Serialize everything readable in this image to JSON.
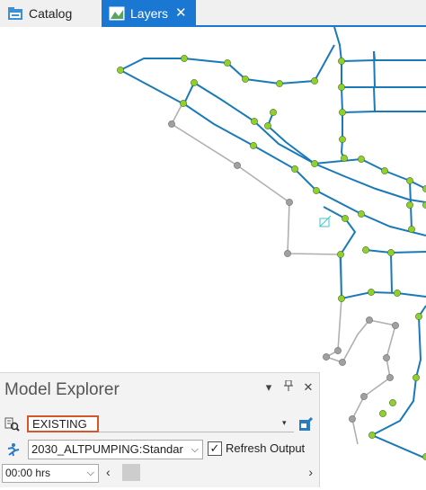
{
  "tabs": [
    {
      "label": "Catalog",
      "icon": "catalog-icon",
      "active": false
    },
    {
      "label": "Layers",
      "icon": "layers-icon",
      "active": true,
      "close": "✕"
    }
  ],
  "panel": {
    "title": "Model Explorer",
    "controls": {
      "menu": "▾",
      "pin": "⊥",
      "close": "✕"
    },
    "scenario": {
      "value": "EXISTING",
      "icon": "scenario-icon",
      "dropdown_icon": "▾",
      "manage_icon": "manage-scenarios-icon"
    },
    "calc_option": {
      "value": "2030_ALTPUMPING:Standar",
      "icon": "calculation-icon",
      "chevron": "⌵"
    },
    "refresh_output": {
      "label": "Refresh Output",
      "checked": true,
      "mark": "✓"
    },
    "time": {
      "value": "00:00 hrs",
      "chevron": "⌵"
    },
    "time_slider": {
      "prev": "‹",
      "next": "›"
    }
  },
  "colors": {
    "accent": "#1a77d2",
    "pipe_active": "#1a7ab8",
    "pipe_inactive": "#b0b0b0",
    "node_active": "#8fd12b",
    "node_inactive": "#a0a0a0",
    "highlight_border": "#d4572b"
  }
}
